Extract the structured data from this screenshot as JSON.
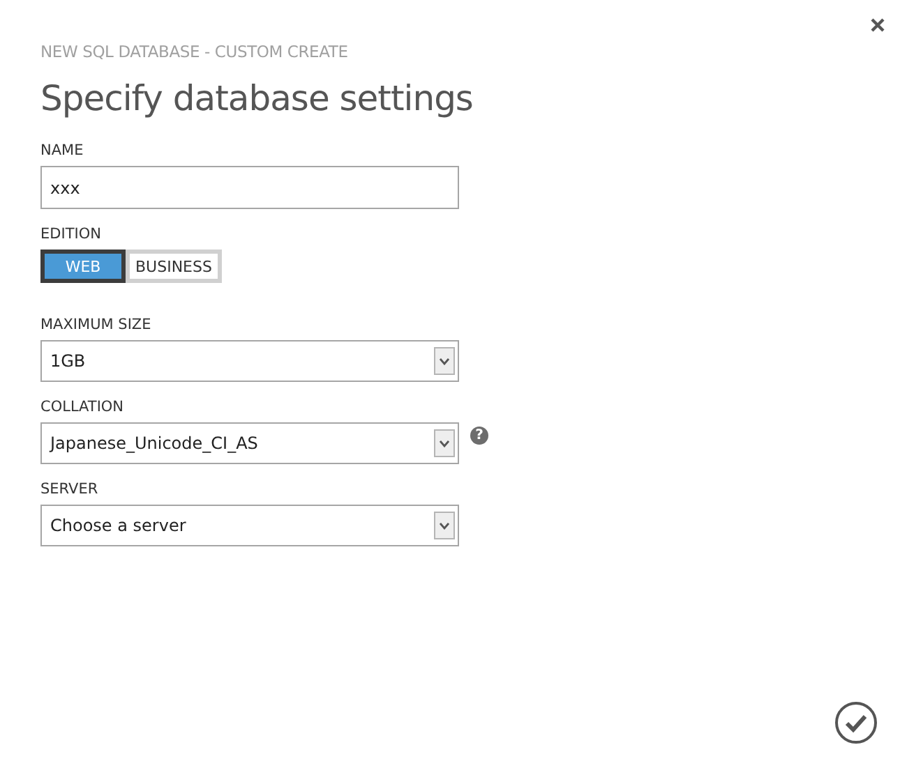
{
  "dialog": {
    "subtitle": "NEW SQL DATABASE - CUSTOM CREATE",
    "title": "Specify database settings"
  },
  "fields": [
    {
      "kind": "text",
      "label": "NAME",
      "value": "xxx"
    },
    {
      "kind": "toggle",
      "label": "EDITION",
      "options": [
        {
          "label": "WEB",
          "selected": true
        },
        {
          "label": "BUSINESS",
          "selected": false
        }
      ]
    },
    {
      "kind": "select",
      "label": "MAXIMUM SIZE",
      "value": "1GB"
    },
    {
      "kind": "select",
      "label": "COLLATION",
      "value": "Japanese_Unicode_CI_AS",
      "help": "?"
    },
    {
      "kind": "select",
      "label": "SERVER",
      "value": "Choose a server"
    }
  ]
}
